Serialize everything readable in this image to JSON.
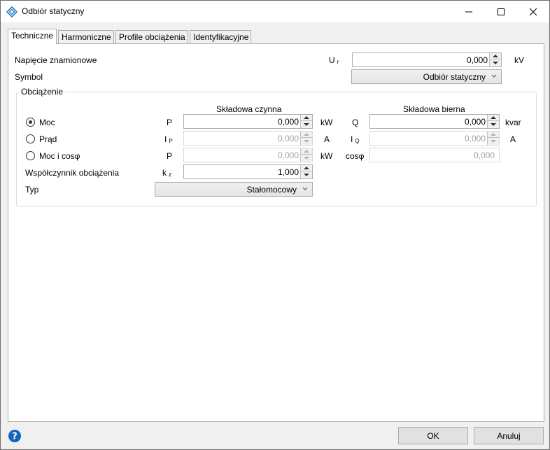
{
  "window": {
    "title": "Odbiór statyczny",
    "minimize_icon": "minimize-icon",
    "maximize_icon": "maximize-icon",
    "close_icon": "close-icon"
  },
  "tabs": [
    {
      "label": "Techniczne",
      "active": true
    },
    {
      "label": "Harmoniczne",
      "active": false
    },
    {
      "label": "Profile obciążenia",
      "active": false
    },
    {
      "label": "Identyfikacyjne",
      "active": false
    }
  ],
  "general": {
    "rated_voltage_label": "Napięcie znamionowe",
    "rated_voltage_symbol": "U",
    "rated_voltage_sub": "r",
    "rated_voltage_value": "0,000",
    "rated_voltage_unit": "kV",
    "symbol_label": "Symbol",
    "symbol_value": "Odbiór statyczny"
  },
  "load": {
    "group_title": "Obciążenie",
    "active_header": "Składowa czynna",
    "reactive_header": "Składowa bierna",
    "rows": [
      {
        "label": "Moc",
        "checked": true,
        "sym1": "P",
        "sub1": "",
        "value1": "0,000",
        "unit1": "kW",
        "sym2": "Q",
        "sub2": "",
        "value2": "0,000",
        "unit2": "kvar",
        "enabled": true
      },
      {
        "label": "Prąd",
        "checked": false,
        "sym1": "I",
        "sub1": "P",
        "value1": "0,000",
        "unit1": "A",
        "sym2": "I",
        "sub2": "Q",
        "value2": "0,000",
        "unit2": "A",
        "enabled": false
      },
      {
        "label": "Moc i cosφ",
        "checked": false,
        "sym1": "P",
        "sub1": "",
        "value1": "0,000",
        "unit1": "kW",
        "sym2": "cosφ",
        "sub2": "",
        "value2": "0,000",
        "unit2": "",
        "enabled": false
      }
    ],
    "factor_label": "Współczynnik obciążenia",
    "factor_symbol": "k",
    "factor_sub": "z",
    "factor_value": "1,000",
    "type_label": "Typ",
    "type_value": "Stałomocowy"
  },
  "footer": {
    "help_icon": "help-icon",
    "ok_label": "OK",
    "cancel_label": "Anuluj"
  },
  "colors": {
    "accent": "#1a6fc9",
    "help": "#1565c0"
  }
}
